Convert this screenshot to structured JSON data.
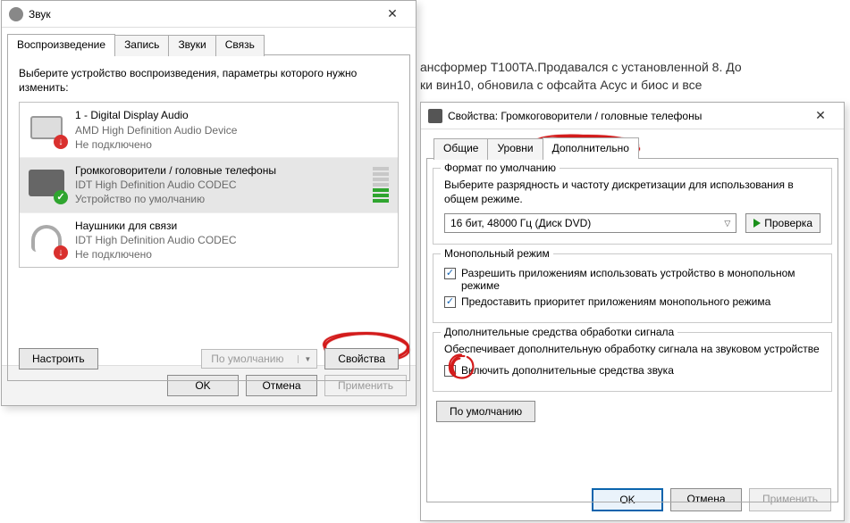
{
  "background": {
    "line1": "ансформер T100TA.Продавался с установленной 8. До",
    "line2": "ки вин10, обновила с офсайта Асус и биос и все"
  },
  "sound_window": {
    "title": "Звук",
    "tabs": [
      "Воспроизведение",
      "Запись",
      "Звуки",
      "Связь"
    ],
    "instruction": "Выберите устройство воспроизведения, параметры которого нужно изменить:",
    "devices": [
      {
        "name": "1 - Digital Display Audio",
        "driver": "AMD High Definition Audio Device",
        "status": "Не подключено",
        "badge": "down"
      },
      {
        "name": "Громкоговорители / головные телефоны",
        "driver": "IDT High Definition Audio CODEC",
        "status": "Устройство по умолчанию",
        "badge": "ok"
      },
      {
        "name": "Наушники для связи",
        "driver": "IDT High Definition Audio CODEC",
        "status": "Не подключено",
        "badge": "down"
      }
    ],
    "buttons": {
      "configure": "Настроить",
      "default": "По умолчанию",
      "properties": "Свойства",
      "ok": "OK",
      "cancel": "Отмена",
      "apply": "Применить"
    }
  },
  "props_window": {
    "title": "Свойства: Громкоговорители / головные телефоны",
    "tabs": [
      "Общие",
      "Уровни",
      "Дополнительно"
    ],
    "format": {
      "legend": "Формат по умолчанию",
      "desc": "Выберите разрядность и частоту дискретизации для использования в общем режиме.",
      "value": "16 бит, 48000 Гц (Диск DVD)",
      "test": "Проверка"
    },
    "exclusive": {
      "legend": "Монопольный режим",
      "opt1": "Разрешить приложениям использовать устройство в монопольном режиме",
      "opt2": "Предоставить приоритет приложениям монопольного режима"
    },
    "enhance": {
      "legend": "Дополнительные средства обработки сигнала",
      "desc": "Обеспечивает дополнительную обработку сигнала на звуковом устройстве",
      "opt": "Включить дополнительные средства звука"
    },
    "defaults_btn": "По умолчанию",
    "buttons": {
      "ok": "OK",
      "cancel": "Отмена",
      "apply": "Применить"
    }
  }
}
